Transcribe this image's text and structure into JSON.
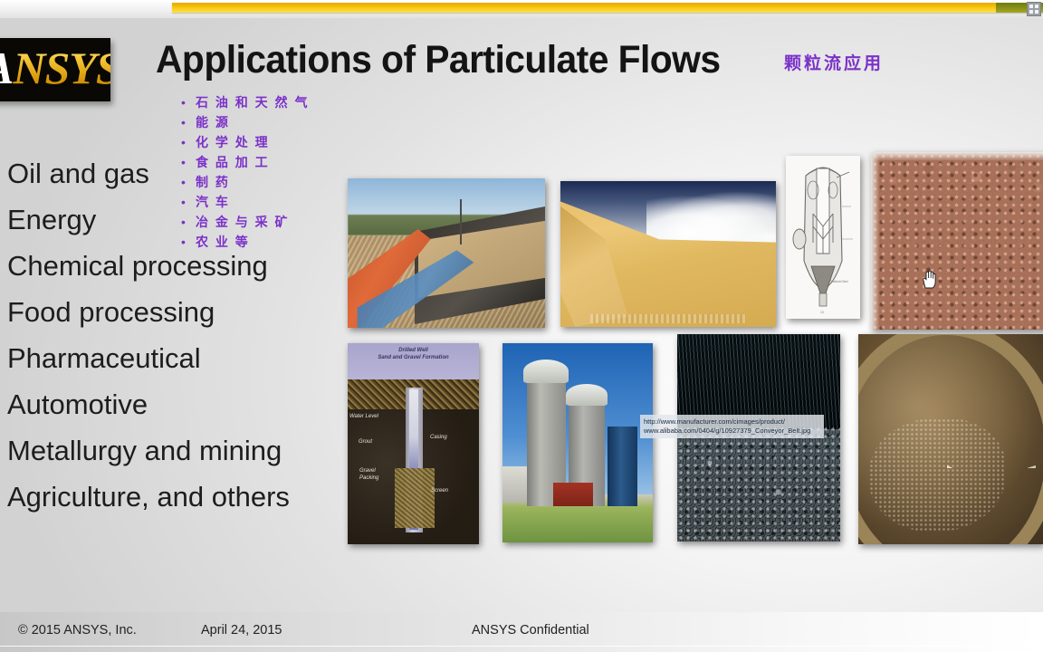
{
  "slide": {
    "title": "Applications of Particulate Flows",
    "title_cn": "颗粒流应用",
    "logo": {
      "a": "A",
      "rest": "NSYS",
      "reg": "®"
    },
    "grid_handle_icon": "grid-handle-icon",
    "cursor_icon": "hand-pan-cursor"
  },
  "list_en": {
    "items": [
      "Oil and gas",
      "Energy",
      "Chemical processing",
      "Food processing",
      "Pharmaceutical",
      "Automotive",
      "Metallurgy and mining",
      "Agriculture, and others"
    ]
  },
  "list_cn": {
    "bullet": "•",
    "items": [
      "石 油 和 天 然 气",
      "能 源",
      "化 学 处 理",
      "食 品 加 工",
      "制 药",
      "汽 车",
      "冶 金 与 采 矿",
      "农 业 等"
    ]
  },
  "images": {
    "conveyor": "conveyor-belt-gravel-photo",
    "dune": "sand-dune-photo",
    "vessel": "fluidized-bed-reactor-drawing",
    "particles": "packed-particle-bed-simulation",
    "well": "drilled-well-diagram",
    "silos": "grain-silos-photo",
    "coal": "falling-coal-particles-photo",
    "mixer": "blue-granules-mixer-photo"
  },
  "well_labels": {
    "header_line1": "Drilled Well",
    "header_line2": "Sand and Gravel Formation",
    "water_level": "Water Level",
    "grout": "Grout",
    "casing": "Casing",
    "gravel_packing_line1": "Gravel",
    "gravel_packing_line2": "Packing",
    "screen": "Screen"
  },
  "watermark": {
    "line1": "http://www.manufacturer.com/cimages/product/",
    "line2": "www.alibaba.com/0404/g/10927379_Conveyor_Belt.jpg"
  },
  "footer": {
    "copyright": "© 2015 ANSYS, Inc.",
    "date": "April 24, 2015",
    "confidential": "ANSYS Confidential"
  },
  "colors": {
    "accent_yellow": "#f0b400",
    "cn_purple": "#7b31c9",
    "title_black": "#141414",
    "logo_gold": "#f2bd1d"
  }
}
